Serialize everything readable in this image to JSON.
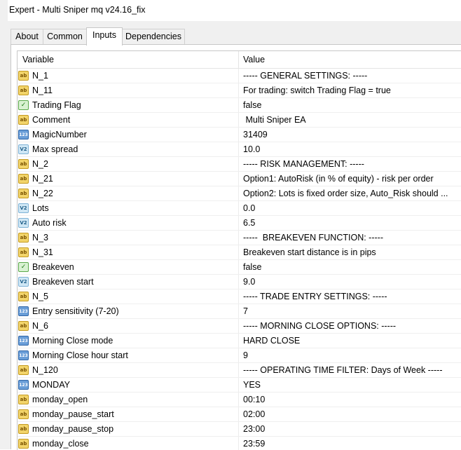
{
  "window": {
    "title": "Expert - Multi Sniper mq v24.16_fix"
  },
  "tabs": [
    {
      "label": "About",
      "active": false
    },
    {
      "label": "Common",
      "active": false
    },
    {
      "label": "Inputs",
      "active": true
    },
    {
      "label": "Dependencies",
      "active": false
    }
  ],
  "table": {
    "headers": {
      "variable": "Variable",
      "value": "Value"
    },
    "rows": [
      {
        "icon": "string-icon",
        "name": "N_1",
        "value": "----- GENERAL SETTINGS: -----"
      },
      {
        "icon": "string-icon",
        "name": "N_11",
        "value": "For trading: switch Trading Flag = true"
      },
      {
        "icon": "bool-icon",
        "name": "Trading Flag",
        "value": "false"
      },
      {
        "icon": "string-icon",
        "name": "Comment",
        "value": " Multi Sniper EA"
      },
      {
        "icon": "int-icon",
        "name": "MagicNumber",
        "value": "31409"
      },
      {
        "icon": "double-icon",
        "name": "Max spread",
        "value": "10.0"
      },
      {
        "icon": "string-icon",
        "name": "N_2",
        "value": "----- RISK MANAGEMENT: -----"
      },
      {
        "icon": "string-icon",
        "name": "N_21",
        "value": "Option1: AutoRisk (in % of equity) - risk per order"
      },
      {
        "icon": "string-icon",
        "name": "N_22",
        "value": "Option2: Lots is fixed order size, Auto_Risk should ..."
      },
      {
        "icon": "double-icon",
        "name": "Lots",
        "value": "0.0"
      },
      {
        "icon": "double-icon",
        "name": "Auto risk",
        "value": "6.5"
      },
      {
        "icon": "string-icon",
        "name": "N_3",
        "value": "-----  BREAKEVEN FUNCTION: -----"
      },
      {
        "icon": "string-icon",
        "name": "N_31",
        "value": "Breakeven start distance is in pips"
      },
      {
        "icon": "bool-icon",
        "name": "Breakeven",
        "value": "false"
      },
      {
        "icon": "double-icon",
        "name": "Breakeven start",
        "value": "9.0"
      },
      {
        "icon": "string-icon",
        "name": "N_5",
        "value": "----- TRADE ENTRY SETTINGS: -----"
      },
      {
        "icon": "int-icon",
        "name": "Entry sensitivity (7-20)",
        "value": "7"
      },
      {
        "icon": "string-icon",
        "name": "N_6",
        "value": "----- MORNING CLOSE OPTIONS: -----"
      },
      {
        "icon": "int-icon",
        "name": "Morning Close mode",
        "value": "HARD CLOSE"
      },
      {
        "icon": "int-icon",
        "name": "Morning Close hour start",
        "value": "9"
      },
      {
        "icon": "string-icon",
        "name": "N_120",
        "value": "----- OPERATING TIME FILTER: Days of Week -----"
      },
      {
        "icon": "int-icon",
        "name": "MONDAY",
        "value": "YES"
      },
      {
        "icon": "string-icon",
        "name": "monday_open",
        "value": "00:10"
      },
      {
        "icon": "string-icon",
        "name": "monday_pause_start",
        "value": "02:00"
      },
      {
        "icon": "string-icon",
        "name": "monday_pause_stop",
        "value": "23:00"
      },
      {
        "icon": "string-icon",
        "name": "monday_close",
        "value": "23:59"
      }
    ]
  }
}
